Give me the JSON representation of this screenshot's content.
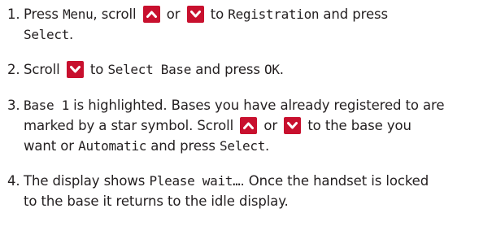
{
  "colors": {
    "text": "#231f20",
    "key_bg": "#c8102e",
    "key_glyph": "#ffffff"
  },
  "icons": {
    "up": "chevron-up-icon",
    "down": "chevron-down-icon"
  },
  "steps": [
    {
      "number": "1.",
      "t1": "Press ",
      "menu": "Menu",
      "t2": ", scroll ",
      "t3": " or ",
      "t4": " to ",
      "registration": "Registration",
      "t5": " and press",
      "select": "Select",
      "t6": "."
    },
    {
      "number": "2.",
      "t1": "Scroll ",
      "t2": " to ",
      "select_base": "Select Base",
      "t3": " and press ",
      "ok": "OK",
      "t4": "."
    },
    {
      "number": "3.",
      "base1": "Base 1",
      "t1": " is highlighted. Bases you have already registered to are",
      "t2": "marked by a star symbol.  Scroll ",
      "t3": " or ",
      "t4": " to the base you",
      "t5": "want or ",
      "automatic": "Automatic",
      "t6": " and press ",
      "select": "Select",
      "t7": "."
    },
    {
      "number": "4.",
      "t1": "The display shows ",
      "please_wait": "Please wait…",
      "t2": ". Once the handset is locked",
      "t3": "to the base it returns to the idle display."
    }
  ]
}
